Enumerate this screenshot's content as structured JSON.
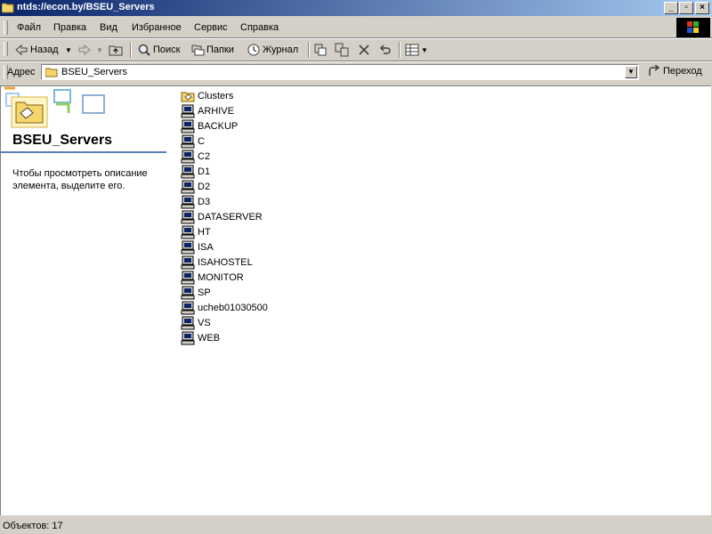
{
  "window": {
    "title": "ntds://econ.by/BSEU_Servers"
  },
  "menu": [
    "Файл",
    "Правка",
    "Вид",
    "Избранное",
    "Сервис",
    "Справка"
  ],
  "toolbar": {
    "back_label": "Назад",
    "search_label": "Поиск",
    "folders_label": "Папки",
    "history_label": "Журнал"
  },
  "address": {
    "label": "Адрес",
    "value": "BSEU_Servers",
    "go_label": "Переход"
  },
  "left_panel": {
    "title": "BSEU_Servers",
    "description": "Чтобы просмотреть описание элемента, выделите его."
  },
  "items": [
    {
      "name": "Clusters",
      "icon": "folder-icon"
    },
    {
      "name": "ARHIVE",
      "icon": "computer-icon"
    },
    {
      "name": "BACKUP",
      "icon": "computer-icon"
    },
    {
      "name": "C",
      "icon": "computer-icon"
    },
    {
      "name": "C2",
      "icon": "computer-icon"
    },
    {
      "name": "D1",
      "icon": "computer-icon"
    },
    {
      "name": "D2",
      "icon": "computer-icon"
    },
    {
      "name": "D3",
      "icon": "computer-icon"
    },
    {
      "name": "DATASERVER",
      "icon": "computer-icon"
    },
    {
      "name": "HT",
      "icon": "computer-icon"
    },
    {
      "name": "ISA",
      "icon": "computer-icon"
    },
    {
      "name": "ISAHOSTEL",
      "icon": "computer-icon"
    },
    {
      "name": "MONITOR",
      "icon": "computer-icon"
    },
    {
      "name": "SP",
      "icon": "computer-icon"
    },
    {
      "name": "ucheb01030500",
      "icon": "computer-icon"
    },
    {
      "name": "VS",
      "icon": "computer-icon"
    },
    {
      "name": "WEB",
      "icon": "computer-icon"
    }
  ],
  "status": {
    "text": "Объектов: 17"
  },
  "colors": {
    "title_start": "#0a246a",
    "title_end": "#a6caf0",
    "face": "#d4d0c8",
    "accent_rule": "#5a7ebc"
  }
}
